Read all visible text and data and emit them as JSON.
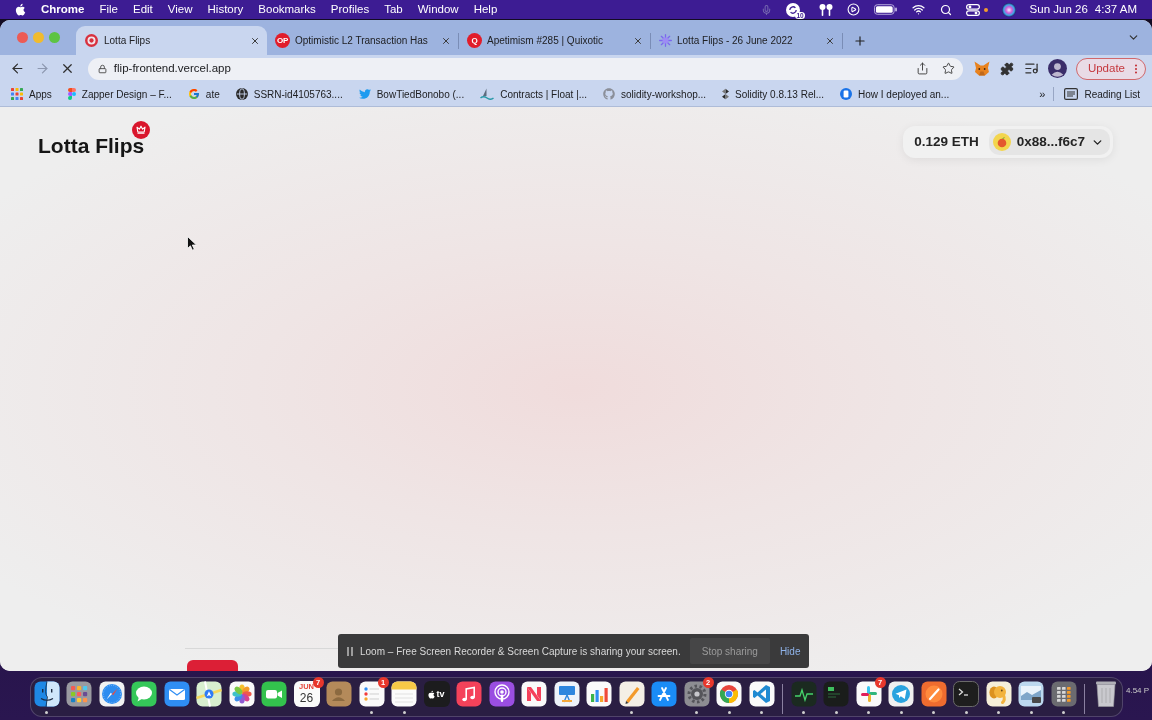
{
  "menu_bar": {
    "app": "Chrome",
    "menus": [
      "File",
      "Edit",
      "View",
      "History",
      "Bookmarks",
      "Profiles",
      "Tab",
      "Window",
      "Help"
    ],
    "status_items": [
      {
        "kind": "mic"
      },
      {
        "kind": "sync",
        "badge": "10"
      },
      {
        "kind": "earbuds"
      },
      {
        "kind": "play"
      },
      {
        "kind": "battery"
      },
      {
        "kind": "wifi"
      },
      {
        "kind": "search"
      },
      {
        "kind": "controls"
      },
      {
        "kind": "dot"
      },
      {
        "kind": "siri"
      }
    ],
    "date": "Sun Jun 26",
    "time": "4:37 AM"
  },
  "browser": {
    "tabs": [
      {
        "title": "Lotta Flips",
        "selected": true,
        "favicon": {
          "kind": "ring"
        }
      },
      {
        "title": "Optimistic L2 Transaction Has",
        "selected": false,
        "favicon": {
          "kind": "badge",
          "text": "OP"
        }
      },
      {
        "title": "Apetimism #285 | Quixotic",
        "selected": false,
        "favicon": {
          "kind": "badge",
          "text": "Q"
        }
      },
      {
        "title": "Lotta Flips - 26 June 2022",
        "selected": false,
        "favicon": {
          "kind": "burst"
        }
      }
    ],
    "toolbar": {
      "back_disabled": false,
      "forward_disabled": true,
      "loading": true,
      "address": "flip-frontend.vercel.app",
      "update": "Update"
    },
    "bookmarks": [
      {
        "title": "Apps",
        "kind": "apps"
      },
      {
        "title": "Zapper Design – F...",
        "kind": "figma"
      },
      {
        "title": "ate",
        "kind": "google"
      },
      {
        "title": "SSRN-id4105763....",
        "kind": "globe"
      },
      {
        "title": "BowTiedBonobo (...",
        "kind": "bird"
      },
      {
        "title": "Contracts | Float |...",
        "kind": "wave"
      },
      {
        "title": "solidity-workshop...",
        "kind": "github"
      },
      {
        "title": "Solidity 0.8.13 Rel...",
        "kind": "diamond"
      },
      {
        "title": "How I deployed an...",
        "kind": "doc"
      }
    ],
    "bookmarks_more": "»",
    "reading_list": "Reading List"
  },
  "page": {
    "logo": "Lotta Flips",
    "balance": "0.129 ETH",
    "account": "0x88...f6c7"
  },
  "loom_bar": {
    "message": "Loom – Free Screen Recorder & Screen Capture is sharing your screen.",
    "stop": "Stop sharing",
    "hide": "Hide"
  },
  "dock": {
    "items": [
      {
        "kind": "finder",
        "running": true
      },
      {
        "kind": "launchpad",
        "running": false
      },
      {
        "kind": "safari",
        "running": false
      },
      {
        "kind": "messages",
        "running": false
      },
      {
        "kind": "mail",
        "running": false
      },
      {
        "kind": "maps",
        "running": false
      },
      {
        "kind": "photos",
        "running": false
      },
      {
        "kind": "facetime",
        "running": false
      },
      {
        "kind": "calendar",
        "month": "JUN",
        "day": "26",
        "badge": "7",
        "running": false
      },
      {
        "kind": "contacts",
        "running": false
      },
      {
        "kind": "reminders",
        "badge": "1",
        "running": true
      },
      {
        "kind": "notes",
        "running": true
      },
      {
        "kind": "tv",
        "label": "tv",
        "running": false
      },
      {
        "kind": "music",
        "running": false
      },
      {
        "kind": "podcasts",
        "running": false
      },
      {
        "kind": "news",
        "running": false
      },
      {
        "kind": "keynote",
        "running": false
      },
      {
        "kind": "numbers",
        "running": false
      },
      {
        "kind": "pages",
        "running": true
      },
      {
        "kind": "appstore",
        "running": false
      },
      {
        "kind": "settings",
        "badge": "2",
        "running": true
      },
      {
        "kind": "chrome",
        "running": true
      },
      {
        "kind": "vscode",
        "running": true
      },
      {
        "kind": "separator"
      },
      {
        "kind": "activity",
        "running": true
      },
      {
        "kind": "shell",
        "running": true
      },
      {
        "kind": "slack",
        "badge": "7",
        "running": true
      },
      {
        "kind": "telegram",
        "running": true
      },
      {
        "kind": "postman",
        "running": true
      },
      {
        "kind": "terminal",
        "running": true
      },
      {
        "kind": "elephant",
        "running": true
      },
      {
        "kind": "preview",
        "running": true
      },
      {
        "kind": "calculator",
        "running": true
      },
      {
        "kind": "separator"
      },
      {
        "kind": "trash"
      }
    ]
  },
  "desktop": {
    "file_label": "4.54 P"
  }
}
